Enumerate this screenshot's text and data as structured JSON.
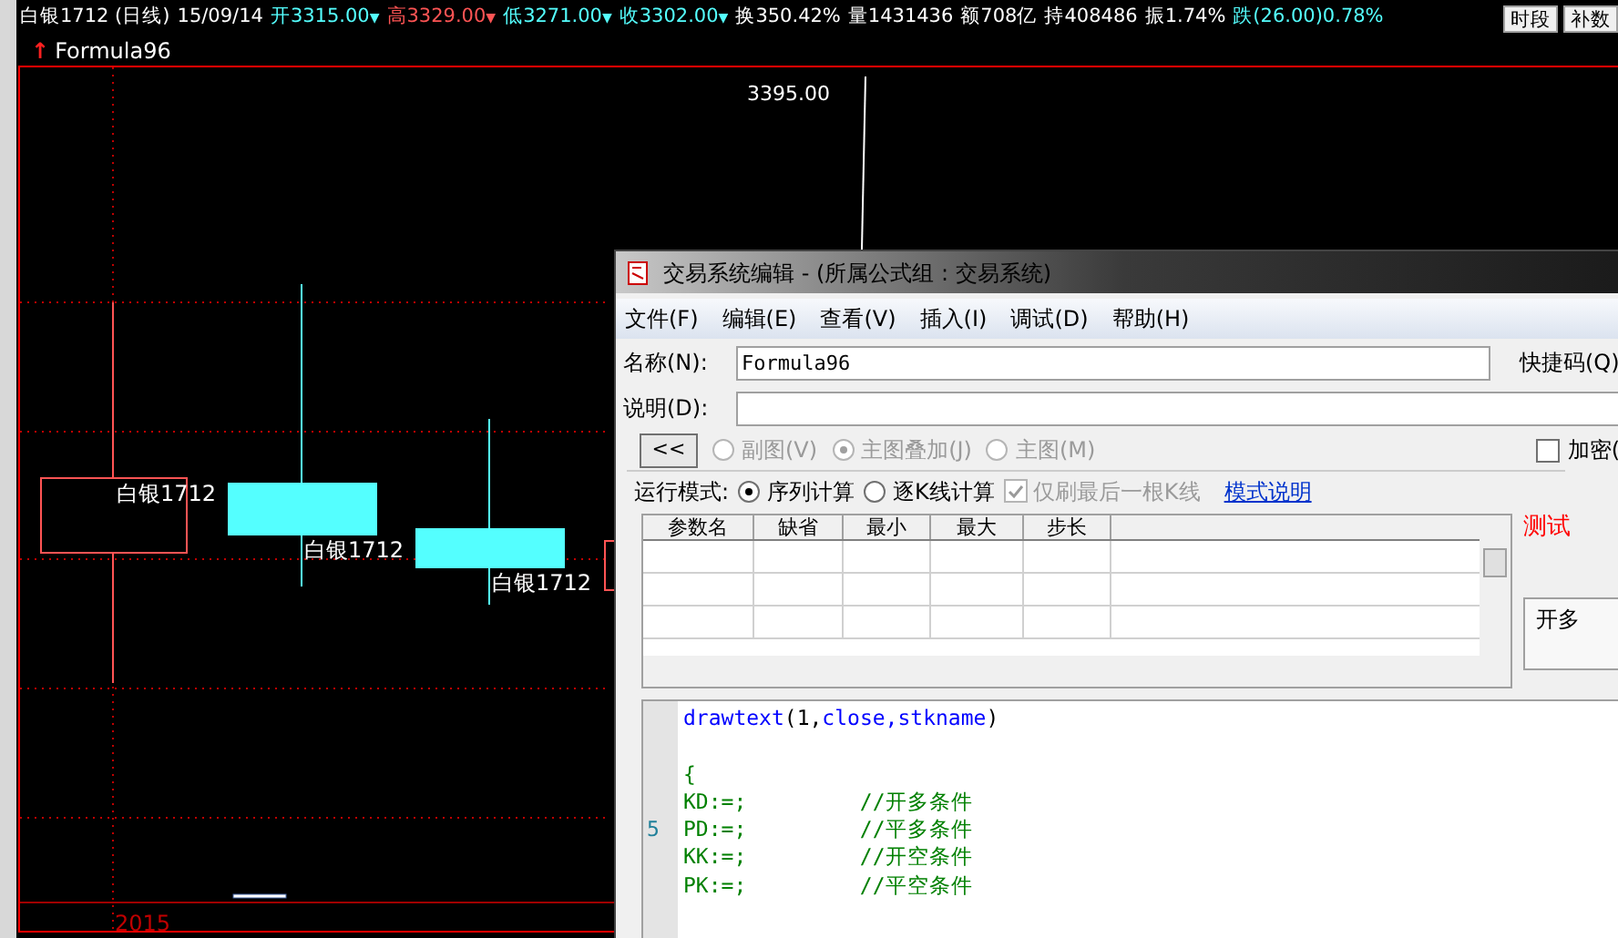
{
  "quote_bar": {
    "items": [
      {
        "text": "白银1712 (日线)",
        "color": "#ffffff"
      },
      {
        "text": "15/09/14",
        "color": "#ffffff"
      },
      {
        "text": "开3315.00",
        "color": "#54ffff",
        "arrow": "▼"
      },
      {
        "text": "高3329.00",
        "color": "#ff5454",
        "arrow": "▼"
      },
      {
        "text": "低3271.00",
        "color": "#54ffff",
        "arrow": "▼"
      },
      {
        "text": "收3302.00",
        "color": "#54ffff",
        "arrow": "▼"
      },
      {
        "text": "换350.42%",
        "color": "#ffffff"
      },
      {
        "text": "量1431436",
        "color": "#ffffff"
      },
      {
        "text": "额708亿",
        "color": "#ffffff"
      },
      {
        "text": "持408486",
        "color": "#ffffff"
      },
      {
        "text": "振1.74%",
        "color": "#ffffff"
      },
      {
        "text": "跌(26.00)0.78%",
        "color": "#54ffff"
      }
    ],
    "buttons": [
      "时段",
      "补数"
    ]
  },
  "indicator": {
    "arrow": "↑",
    "name": "Formula96"
  },
  "chart": {
    "price_label": "3395.00",
    "axis_label": "2015",
    "candle_labels": [
      "白银1712",
      "白银1712",
      "白银1712"
    ]
  },
  "dialog": {
    "title": "交易系统编辑 - (所属公式组 : 交易系统)",
    "menu": [
      "文件(F)",
      "编辑(E)",
      "查看(V)",
      "插入(I)",
      "调试(D)",
      "帮助(H)"
    ],
    "name_label": "名称(N):",
    "name_value": "Formula96",
    "shortcut_label": "快捷码(Q)",
    "desc_label": "说明(D):",
    "collapse_button": "<<",
    "chart_modes": [
      {
        "label": "副图(V)",
        "selected": false,
        "disabled": true
      },
      {
        "label": "主图叠加(J)",
        "selected": true,
        "disabled": true
      },
      {
        "label": "主图(M)",
        "selected": false,
        "disabled": true
      }
    ],
    "encrypt": {
      "label": "加密(",
      "checked": false
    },
    "run_mode_label": "运行模式:",
    "run_modes": [
      {
        "label": "序列计算",
        "selected": true
      },
      {
        "label": "逐K线计算",
        "selected": false
      }
    ],
    "refresh_last": {
      "label": "仅刷最后一根K线",
      "checked": true,
      "disabled": true
    },
    "mode_help_link": "模式说明",
    "param_columns": [
      "参数名",
      "缺省",
      "最小",
      "最大",
      "步长"
    ],
    "test_label": "测试",
    "side_tab": "开多",
    "code_lines": [
      {
        "segments": [
          {
            "text": "drawtext",
            "kind": "keyword"
          },
          {
            "text": "(1,",
            "kind": "plain"
          },
          {
            "text": "close,",
            "kind": "keyword"
          },
          {
            "text": "stkname",
            "kind": "keyword"
          },
          {
            "text": ")",
            "kind": "plain"
          }
        ]
      },
      {
        "blank_before": true,
        "segments": [
          {
            "text": "{",
            "kind": "comment"
          }
        ]
      },
      {
        "segments": [
          {
            "text": "KD:=;",
            "kind": "comment"
          },
          {
            "text": "         //开多条件",
            "kind": "comment"
          }
        ]
      },
      {
        "number": "5",
        "segments": [
          {
            "text": "PD:=;",
            "kind": "comment"
          },
          {
            "text": "         //平多条件",
            "kind": "comment"
          }
        ]
      },
      {
        "segments": [
          {
            "text": "KK:=;",
            "kind": "comment"
          },
          {
            "text": "         //开空条件",
            "kind": "comment"
          }
        ]
      },
      {
        "segments": [
          {
            "text": "PK:=;",
            "kind": "comment"
          },
          {
            "text": "         //平空条件",
            "kind": "comment"
          }
        ]
      }
    ]
  }
}
